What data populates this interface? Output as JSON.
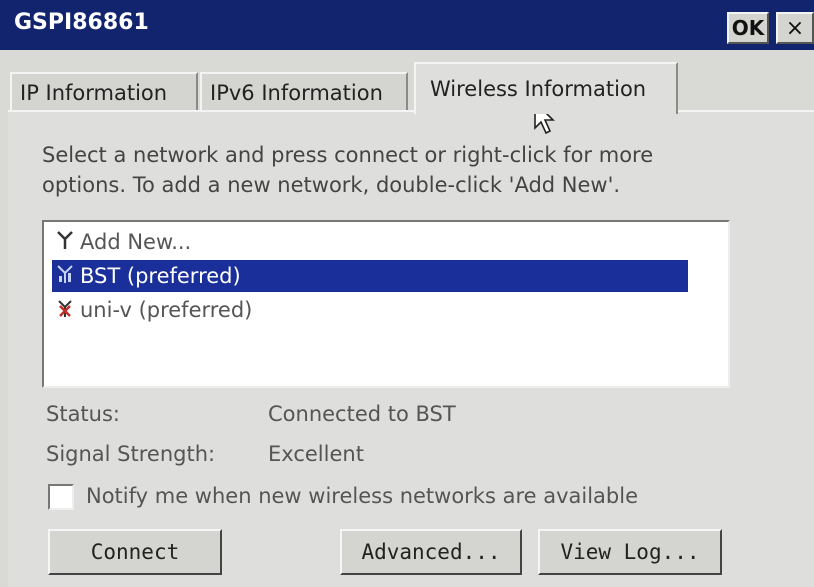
{
  "window": {
    "title": "GSPI86861",
    "ok_label": "OK",
    "close_label": "×"
  },
  "tabs": [
    {
      "label": "IP Information"
    },
    {
      "label": "IPv6 Information"
    },
    {
      "label": "Wireless Information",
      "selected": true
    }
  ],
  "instructions": {
    "line1": "Select a network and press connect or right-click for more",
    "line2": "options.  To add a new network, double-click 'Add New'."
  },
  "networks": [
    {
      "label": "Add New...",
      "icon": "antenna-icon"
    },
    {
      "label": "BST (preferred)",
      "icon": "signal-bars-icon",
      "selected": true
    },
    {
      "label": "uni-v (preferred)",
      "icon": "antenna-disconnected-icon"
    }
  ],
  "status": {
    "status_label": "Status:",
    "status_value": "Connected to BST",
    "signal_label": "Signal Strength:",
    "signal_value": "Excellent"
  },
  "notify": {
    "label": "Notify me when new wireless networks are available",
    "checked": false
  },
  "buttons": {
    "connect": "Connect",
    "advanced": "Advanced...",
    "view_log": "View Log..."
  },
  "colors": {
    "titlebar": "#12246e",
    "selection": "#1a2f9a",
    "panel": "#dededc"
  }
}
